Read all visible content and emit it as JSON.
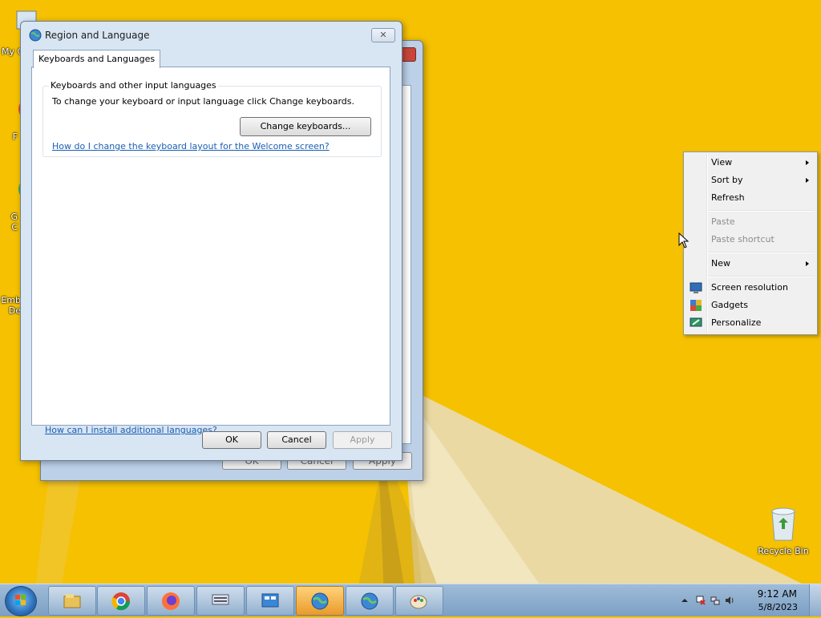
{
  "dialog": {
    "title": "Region and Language",
    "close_glyph": "✕",
    "tab_label": "Keyboards and Languages",
    "group_title": "Keyboards and other input languages",
    "group_desc": "To change your keyboard or input language click Change keyboards.",
    "change_keyboards_label": "Change keyboards...",
    "welcome_link": "How do I change the keyboard layout for the Welcome screen?",
    "install_link": "How can I install additional languages?",
    "ok_label": "OK",
    "cancel_label": "Cancel",
    "apply_label": "Apply"
  },
  "back_dialog": {
    "ok_label": "OK",
    "cancel_label": "Cancel",
    "apply_label": "Apply"
  },
  "desktop_icons": {
    "icon1_label": "My C",
    "icon2_label": "F",
    "icon3_label": "G\nC",
    "icon4_label": "Emb\nDe",
    "recycle_bin_label": "Recycle Bin"
  },
  "context_menu": {
    "view": "View",
    "sort_by": "Sort by",
    "refresh": "Refresh",
    "paste": "Paste",
    "paste_shortcut": "Paste shortcut",
    "new": "New",
    "screen_resolution": "Screen resolution",
    "gadgets": "Gadgets",
    "personalize": "Personalize"
  },
  "taskbar": {
    "time": "9:12 AM",
    "date": "5/8/2023",
    "apps": [
      "file-explorer-icon",
      "chrome-icon",
      "firefox-icon",
      "keyboard-settings-icon",
      "control-panel-icon",
      "region-language-icon",
      "region-language-icon-2",
      "paint-icon"
    ]
  },
  "colors": {
    "desktop_bg": "#f5c100",
    "link": "#1a5fb4",
    "active_taskbar": "#e99a2b"
  }
}
